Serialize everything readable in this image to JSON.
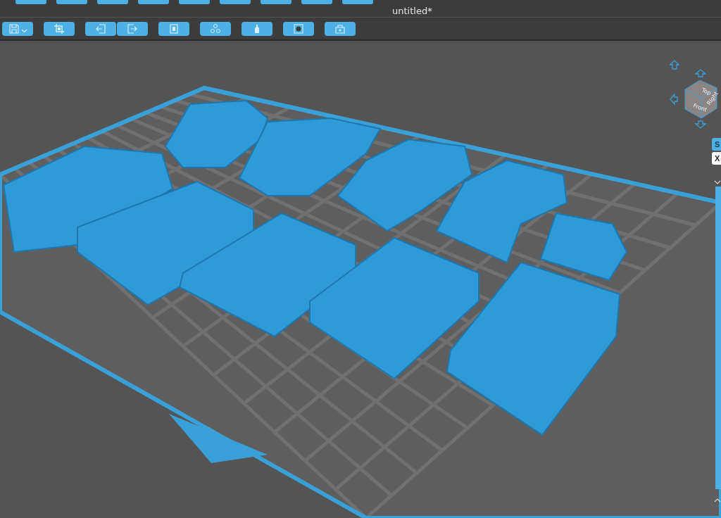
{
  "window": {
    "title": "untitled*"
  },
  "view_cube": {
    "faces": [
      "Top",
      "Front",
      "Right"
    ]
  },
  "layer_slider": {
    "level": 1
  },
  "side_panel": {
    "tabs": [
      {
        "label": "S",
        "selected": true
      },
      {
        "label": "X",
        "selected": false
      }
    ]
  }
}
